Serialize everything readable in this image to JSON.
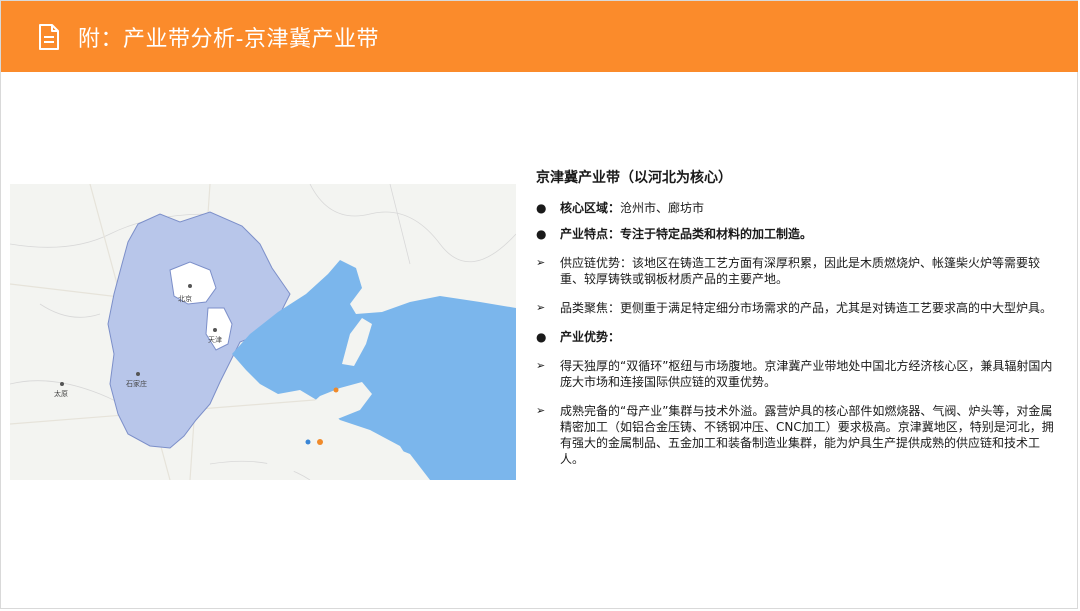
{
  "header": {
    "icon": "document-icon",
    "title": "附：产业带分析-京津冀产业带",
    "color": "#fb8b2b"
  },
  "map": {
    "labels": {
      "beijing": "北京",
      "tianjin": "天津",
      "shijiazhuang": "石家庄",
      "taiyuan": "太原"
    }
  },
  "content": {
    "heading": "京津冀产业带（以河北为核心）",
    "core_label": "核心区域：",
    "core_value": "沧州市、廊坊市",
    "feature_title": "产业特点：专注于特定品类和材料的加工制造。",
    "supply": "供应链优势：该地区在铸造工艺方面有深厚积累，因此是木质燃烧炉、帐篷柴火炉等需要较重、较厚铸铁或钢板材质产品的主要产地。",
    "category": "品类聚焦：更侧重于满足特定细分市场需求的产品，尤其是对铸造工艺要求高的中大型炉具。",
    "advantage_title": "产业优势：",
    "advantage_1": "得天独厚的“双循环”枢纽与市场腹地。京津冀产业带地处中国北方经济核心区，兼具辐射国内庞大市场和连接国际供应链的双重优势。",
    "advantage_2": "成熟完备的“母产业”集群与技术外溢。露营炉具的核心部件如燃烧器、气阀、炉头等，对金属精密加工（如铝合金压铸、不锈钢冲压、CNC加工）要求极高。京津冀地区，特别是河北，拥有强大的金属制品、五金加工和装备制造业集群，能为炉具生产提供成熟的供应链和技术工人。",
    "bullet": "●",
    "arrow": "➢"
  }
}
